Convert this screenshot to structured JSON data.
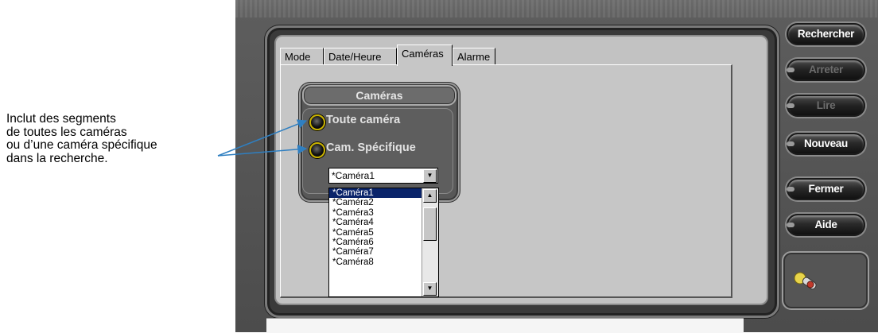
{
  "annotation": {
    "lines": [
      "Inclut des segments",
      "de toutes les caméras",
      "ou d’une caméra spécifique",
      "dans la recherche."
    ]
  },
  "tabs": [
    {
      "label": "Mode",
      "active": false
    },
    {
      "label": "Date/Heure",
      "active": false
    },
    {
      "label": "Caméras",
      "active": true
    },
    {
      "label": "Alarme",
      "active": false
    }
  ],
  "cameras_group": {
    "title": "Caméras",
    "options": [
      {
        "label": "Toute caméra"
      },
      {
        "label": "Cam. Spécifique"
      }
    ],
    "selected_camera": "*Caméra1",
    "dropdown_items": [
      "*Caméra1",
      "*Caméra2",
      "*Caméra3",
      "*Caméra4",
      "*Caméra5",
      "*Caméra6",
      "*Caméra7",
      "*Caméra8"
    ],
    "highlighted_index": 0
  },
  "buttons": [
    {
      "label": "Rechercher",
      "enabled": true
    },
    {
      "label": "Arreter",
      "enabled": false
    },
    {
      "label": "Lire",
      "enabled": false
    },
    {
      "label": "Nouveau",
      "enabled": true
    },
    {
      "label": "Fermer",
      "enabled": true
    },
    {
      "label": "Aide",
      "enabled": true
    }
  ],
  "icons": {
    "dropdown_arrow": "chevron-down-icon",
    "scroll_up": "chevron-up-icon",
    "scroll_down": "chevron-down-icon",
    "logo": "joystick-logo-icon"
  },
  "colors": {
    "selection": "#0a246a",
    "radio_ring": "#c9b200",
    "arrow": "#2f7fc1"
  }
}
